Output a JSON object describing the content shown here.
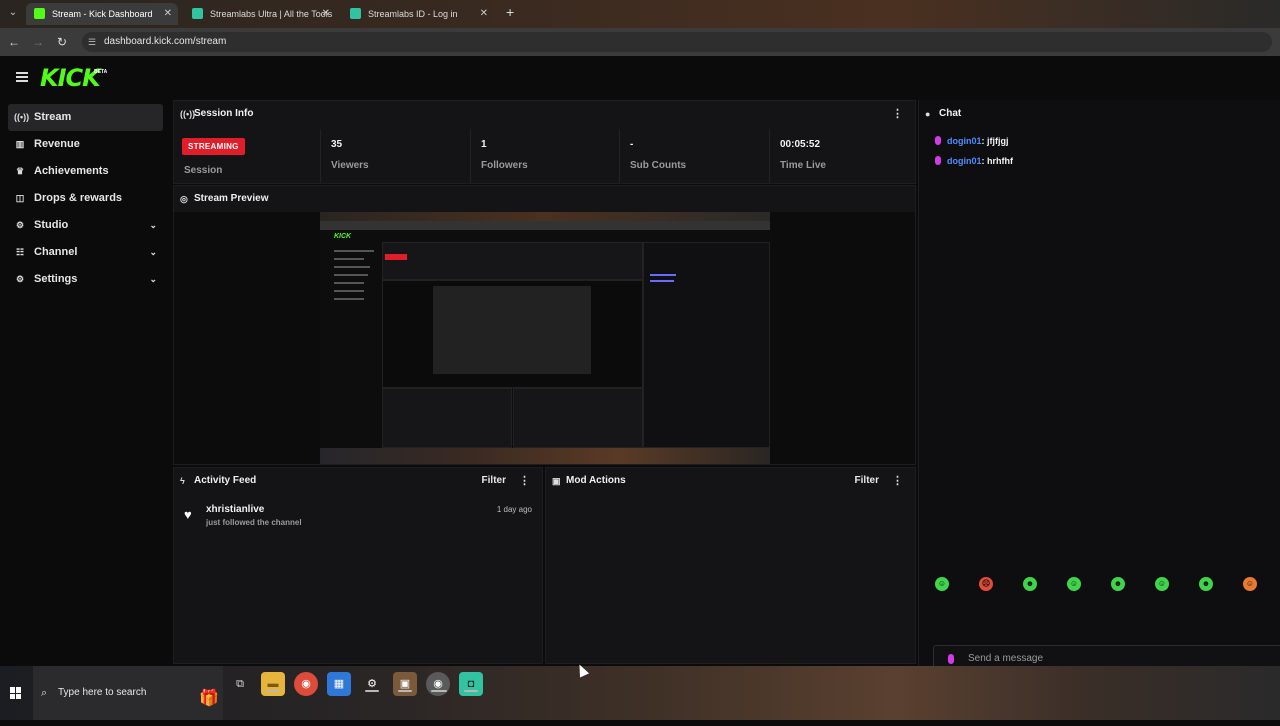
{
  "browser": {
    "tabs": [
      {
        "title": "Stream - Kick Dashboard",
        "active": true,
        "favicon_color": "#53fc18"
      },
      {
        "title": "Streamlabs Ultra | All the Tools",
        "active": false,
        "favicon_color": "#31c3a2"
      },
      {
        "title": "Streamlabs ID - Log in",
        "active": false,
        "favicon_color": "#31c3a2"
      }
    ],
    "tab_close": "✕",
    "new_tab": "+",
    "url": "dashboard.kick.com/stream"
  },
  "header": {
    "logo": "KICK",
    "beta": "BETA"
  },
  "sidebar": {
    "items": [
      {
        "label": "Stream",
        "icon": "broadcast-icon",
        "glyph": "((•))",
        "active": true,
        "chevron": false
      },
      {
        "label": "Revenue",
        "icon": "chart-icon",
        "glyph": "▥",
        "active": false,
        "chevron": false
      },
      {
        "label": "Achievements",
        "icon": "trophy-icon",
        "glyph": "♛",
        "active": false,
        "chevron": false
      },
      {
        "label": "Drops & rewards",
        "icon": "gift-icon",
        "glyph": "◫",
        "active": false,
        "chevron": false
      },
      {
        "label": "Studio",
        "icon": "studio-icon",
        "glyph": "⚙",
        "active": false,
        "chevron": true
      },
      {
        "label": "Channel",
        "icon": "channel-icon",
        "glyph": "☷",
        "active": false,
        "chevron": true
      },
      {
        "label": "Settings",
        "icon": "gear-icon",
        "glyph": "⚙",
        "active": false,
        "chevron": true
      }
    ],
    "chevron_glyph": "⌄"
  },
  "session_info": {
    "title": "Session Info",
    "stats": [
      {
        "value": "STREAMING",
        "label": "Session",
        "is_badge": true
      },
      {
        "value": "35",
        "label": "Viewers"
      },
      {
        "value": "1",
        "label": "Followers"
      },
      {
        "value": "-",
        "label": "Sub Counts"
      },
      {
        "value": "00:05:52",
        "label": "Time Live"
      }
    ]
  },
  "stream_preview": {
    "title": "Stream Preview"
  },
  "activity_feed": {
    "title": "Activity Feed",
    "filter": "Filter",
    "items": [
      {
        "name": "xhristianlive",
        "desc": "just followed the channel",
        "time": "1 day ago"
      }
    ]
  },
  "mod_actions": {
    "title": "Mod Actions",
    "filter": "Filter"
  },
  "chat": {
    "title": "Chat",
    "messages": [
      {
        "user": "dogin01",
        "text": ": jfjfjgj"
      },
      {
        "user": "dogin01",
        "text": ": hrhfhf"
      }
    ],
    "emote_colors": [
      "#3fd44a",
      "#e24a3a",
      "#3fd44a",
      "#3fd44a",
      "#3fd44a",
      "#3fd44a",
      "#3fd44a",
      "#e87a30"
    ],
    "input_placeholder": "Send a message"
  },
  "taskbar": {
    "search_placeholder": "Type here to search",
    "apps": [
      {
        "name": "task-view-icon",
        "glyph": "⧉",
        "color": "#2b2b2e"
      },
      {
        "name": "file-explorer-icon",
        "glyph": "▬",
        "color": "#e7b53c"
      },
      {
        "name": "chrome-icon",
        "glyph": "◉",
        "color": "#dd4b39"
      },
      {
        "name": "store-icon",
        "glyph": "▦",
        "color": "#2f78d8"
      },
      {
        "name": "settings-icon",
        "glyph": "⚙",
        "color": "#3a3a3e"
      },
      {
        "name": "minecraft-icon",
        "glyph": "▣",
        "color": "#7a5a3a"
      },
      {
        "name": "chrome-active-icon",
        "glyph": "◉",
        "color": "#5a5a5a"
      },
      {
        "name": "streamlabs-icon",
        "glyph": "◘",
        "color": "#31c3a2"
      }
    ]
  }
}
